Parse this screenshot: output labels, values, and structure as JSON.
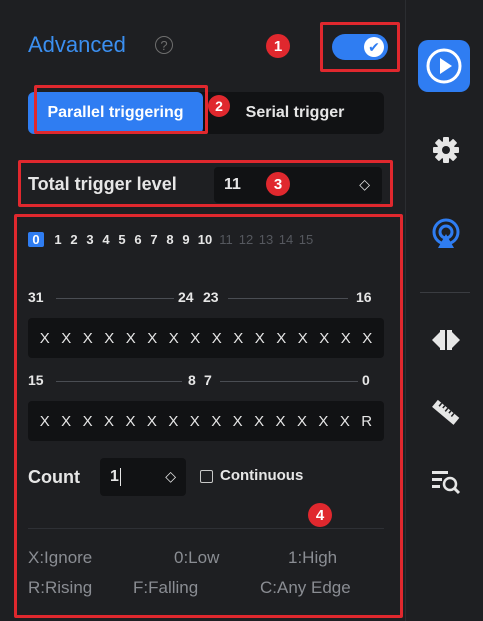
{
  "header": {
    "title": "Advanced",
    "help_icon": "question-circle-icon",
    "help_glyph": "?"
  },
  "toggle": {
    "enabled": true,
    "icon": "check-icon",
    "glyph": "✔"
  },
  "mode_tabs": {
    "active": "Parallel triggering",
    "inactive": "Serial trigger"
  },
  "trigger_level": {
    "label": "Total trigger level",
    "value": "11",
    "chevron": "◇"
  },
  "bit_selector": {
    "active_bits": [
      "0",
      "1",
      "2",
      "3",
      "4",
      "5",
      "6",
      "7",
      "8",
      "9",
      "10"
    ],
    "disabled_bits": [
      "11",
      "12",
      "13",
      "14",
      "15"
    ],
    "selected": "0"
  },
  "upper_range": {
    "left": "31",
    "mid_left": "24",
    "mid_right": "23",
    "right": "16"
  },
  "upper_pattern": [
    "X",
    "X",
    "X",
    "X",
    "X",
    "X",
    "X",
    "X",
    "X",
    "X",
    "X",
    "X",
    "X",
    "X",
    "X",
    "X"
  ],
  "lower_range": {
    "left": "15",
    "mid_left": "8",
    "mid_right": "7",
    "right": "0"
  },
  "lower_pattern": [
    "X",
    "X",
    "X",
    "X",
    "X",
    "X",
    "X",
    "X",
    "X",
    "X",
    "X",
    "X",
    "X",
    "X",
    "X",
    "R"
  ],
  "count": {
    "label": "Count",
    "value": "1",
    "chevron": "◇"
  },
  "continuous": {
    "label": "Continuous",
    "checked": false
  },
  "legend": {
    "ignore": "X:Ignore",
    "low": "0:Low",
    "high": "1:High",
    "rising": "R:Rising",
    "falling": "F:Falling",
    "any_edge": "C:Any Edge"
  },
  "annotations": [
    "1",
    "2",
    "3",
    "4"
  ],
  "sidebar_icons": [
    "play-icon",
    "gear-icon",
    "broadcast-icon",
    "waveform-icon",
    "ruler-icon",
    "search-list-icon"
  ],
  "colors": {
    "accent": "#2f7df2",
    "background": "#1e1f22",
    "highlight": "#e0282e",
    "title": "#3b8ff0"
  }
}
